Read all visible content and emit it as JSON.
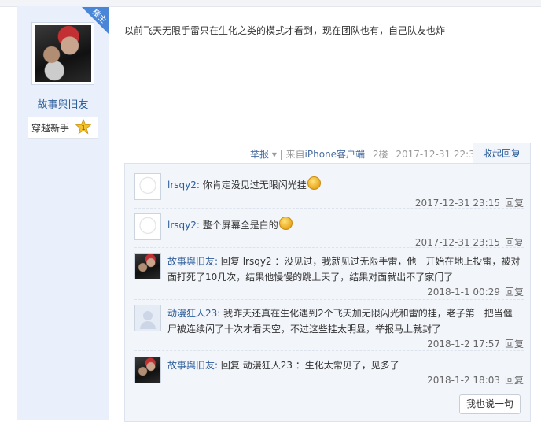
{
  "post": {
    "badge": "楼主",
    "author": "故事與旧友",
    "rank": "穿越新手",
    "content": "以前飞天无限手雷只在生化之类的模式才看到，现在团队也有，自己队友也炸",
    "meta": {
      "report": "举报",
      "source_prefix": "来自",
      "source": "iPhone客户端",
      "floor": "2楼",
      "time": "2017-12-31 22:39"
    },
    "collapse_label": "收起回复"
  },
  "replies": [
    {
      "author": "lrsqy2:",
      "text": "你肯定没见过无限闪光挂",
      "time": "2017-12-31 23:15",
      "reply_label": "回复"
    },
    {
      "author": "lrsqy2:",
      "text": "整个屏幕全是白的",
      "time": "2017-12-31 23:15",
      "reply_label": "回复"
    },
    {
      "author": "故事與旧友:",
      "text": "回复 lrsqy2 ：没见过，我就见过无限手雷，他一开始在地上投雷，被对面打死了10几次，结果他慢慢的跳上天了，结果对面就出不了家门了",
      "time": "2018-1-1 00:29",
      "reply_label": "回复"
    },
    {
      "author": "动漫狂人23:",
      "text": "我昨天还真在生化遇到2个飞天加无限闪光和雷的挂，老子第一把当僵尸被连续闪了十次才看天空，不过这些挂太明显，举报马上就封了",
      "time": "2018-1-2 17:57",
      "reply_label": "回复"
    },
    {
      "author": "故事與旧友:",
      "text": "回复 动漫狂人23 ：生化太常见了，见多了",
      "time": "2018-1-2 18:03",
      "reply_label": "回复"
    }
  ],
  "say_button": "我也说一句"
}
